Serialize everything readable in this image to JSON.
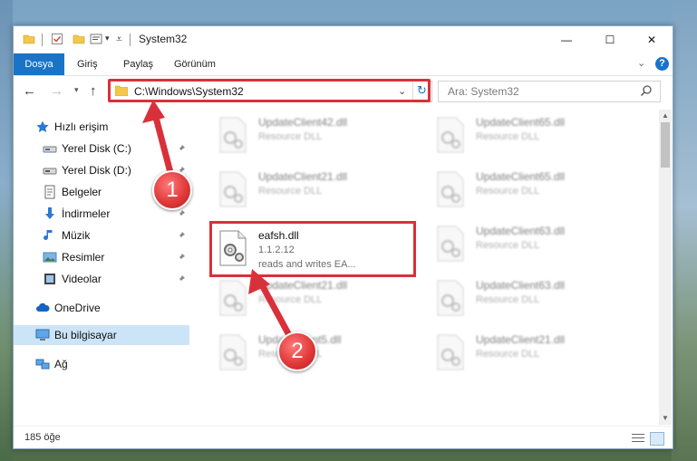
{
  "window": {
    "title": "System32",
    "controls": {
      "minimize": "—",
      "maximize": "☐",
      "close": "✕"
    }
  },
  "ribbon": {
    "file_tab": "Dosya",
    "tabs": [
      "Giriş",
      "Paylaş",
      "Görünüm"
    ]
  },
  "nav": {
    "address": "C:\\Windows\\System32",
    "search_placeholder": "Ara: System32"
  },
  "sidebar": {
    "items": [
      {
        "label": "Hızlı erişim",
        "icon": "star-icon",
        "pinned": false
      },
      {
        "label": "Yerel Disk (C:)",
        "icon": "drive-icon",
        "pinned": true
      },
      {
        "label": "Yerel Disk (D:)",
        "icon": "drive-icon",
        "pinned": true
      },
      {
        "label": "Belgeler",
        "icon": "documents-icon",
        "pinned": true
      },
      {
        "label": "İndirmeler",
        "icon": "download-icon",
        "pinned": true
      },
      {
        "label": "Müzik",
        "icon": "music-icon",
        "pinned": true
      },
      {
        "label": "Resimler",
        "icon": "pictures-icon",
        "pinned": true
      },
      {
        "label": "Videolar",
        "icon": "video-icon",
        "pinned": true
      },
      {
        "label": "OneDrive",
        "icon": "cloud-icon",
        "pinned": false
      },
      {
        "label": "Bu bilgisayar",
        "icon": "computer-icon",
        "pinned": false,
        "selected": true
      },
      {
        "label": "Ağ",
        "icon": "network-icon",
        "pinned": false
      }
    ]
  },
  "files": [
    {
      "name": "UpdateClient42.dll",
      "desc": "Resource DLL"
    },
    {
      "name": "UpdateClient65.dll",
      "desc": "Resource DLL"
    },
    {
      "name": "UpdateClient21.dll",
      "desc": "Resource DLL"
    },
    {
      "name": "UpdateClient65.dll",
      "desc": "Resource DLL"
    },
    {
      "name": "eafsh.dll",
      "version": "1.1.2.12",
      "desc": "reads and writes EA..."
    },
    {
      "name": "UpdateClient63.dll",
      "desc": "Resource DLL"
    },
    {
      "name": "UpdateClient21.dll",
      "desc": "Resource DLL"
    },
    {
      "name": "UpdateClient63.dll",
      "desc": "Resource DLL"
    },
    {
      "name": "UpdateClient5.dll",
      "desc": "Resource DLL"
    },
    {
      "name": "UpdateClient21.dll",
      "desc": "Resource DLL"
    }
  ],
  "status": {
    "count": "185 öğe"
  },
  "callouts": {
    "step1": "1",
    "step2": "2"
  },
  "colors": {
    "accent": "#1a73c7",
    "highlight": "#d9313a",
    "selected_bg": "#cce4f7"
  }
}
